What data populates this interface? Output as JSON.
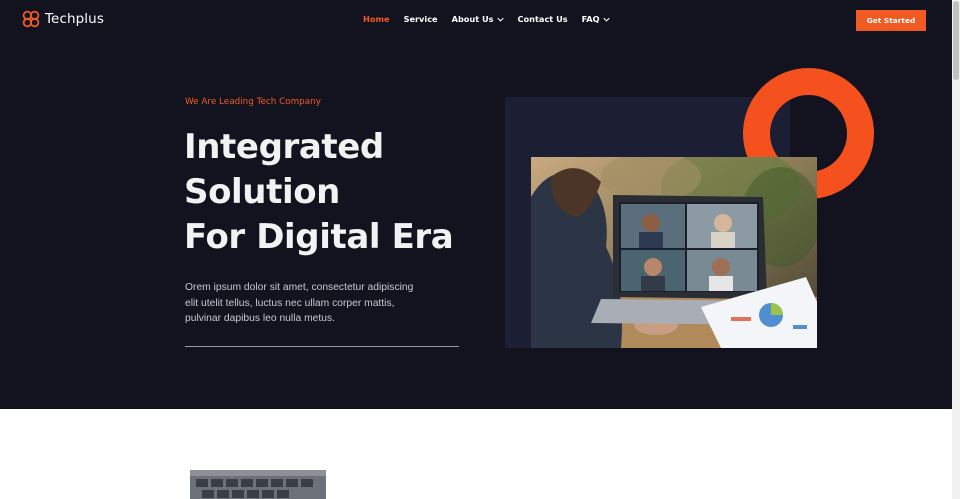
{
  "brand": {
    "name": "Techplus",
    "accent": "#f15a22",
    "background": "#12131f"
  },
  "nav": {
    "items": [
      {
        "label": "Home",
        "active": true,
        "dropdown": false
      },
      {
        "label": "Service",
        "active": false,
        "dropdown": false
      },
      {
        "label": "About Us",
        "active": false,
        "dropdown": true
      },
      {
        "label": "Contact Us",
        "active": false,
        "dropdown": false
      },
      {
        "label": "FAQ",
        "active": false,
        "dropdown": true
      }
    ]
  },
  "header": {
    "cta_label": "Get Started"
  },
  "hero": {
    "tagline": "We Are Leading Tech Company",
    "headline": [
      "Integrated",
      "Solution",
      "For Digital Era"
    ],
    "description": "Orem ipsum dolor sit amet, consectetur adipiscing elit utelit tellus, luctus nec ullam corper mattis, pulvinar dapibus leo nulla metus."
  },
  "icons": [
    "techplus-logo-icon",
    "chevron-down-icon"
  ]
}
